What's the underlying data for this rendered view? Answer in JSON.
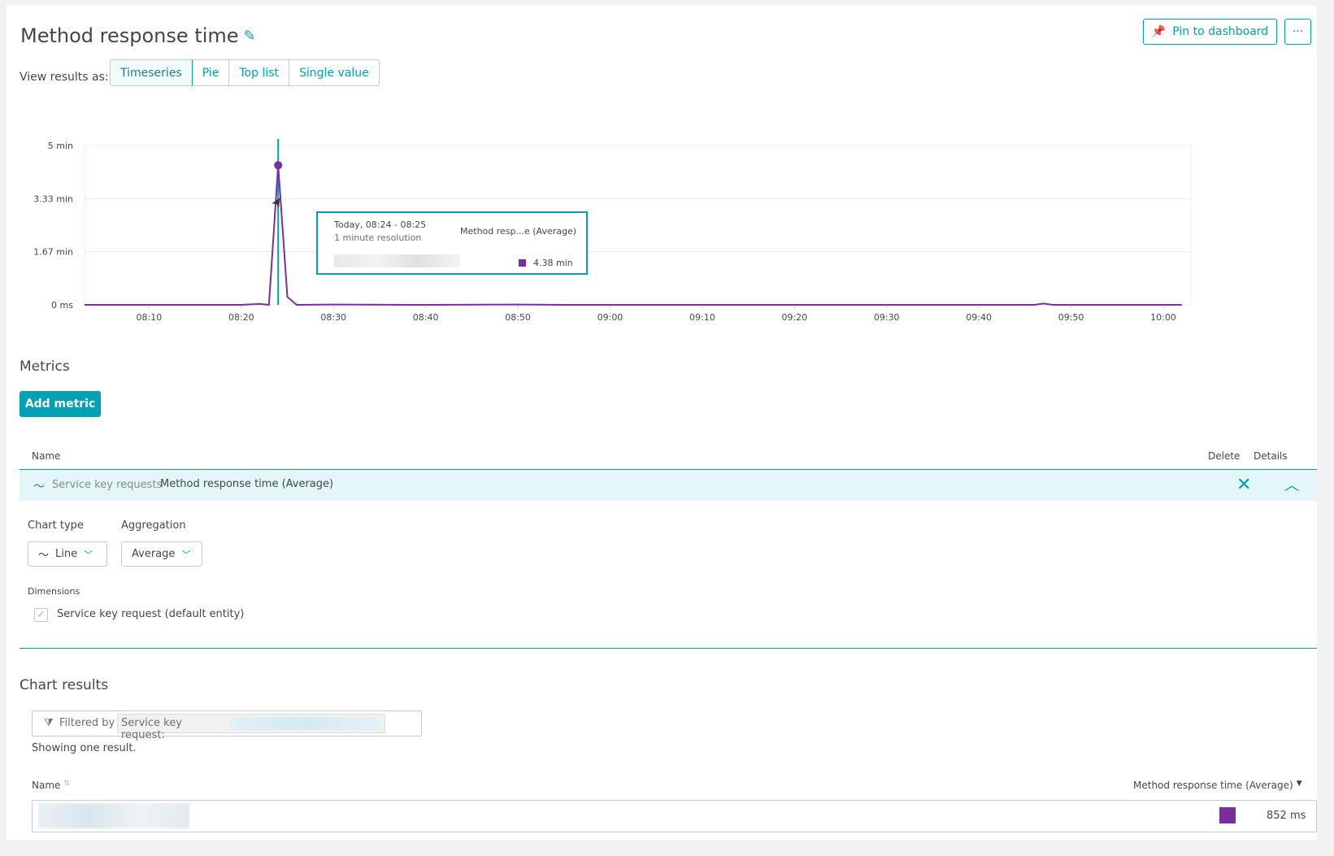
{
  "header": {
    "title": "Method response time",
    "pin_label": "Pin to dashboard",
    "more_label": "···",
    "view_label": "View results as:",
    "view_options": [
      "Timeseries",
      "Pie",
      "Top list",
      "Single value"
    ],
    "view_selected": "Timeseries"
  },
  "chart_data": {
    "type": "line",
    "title": "",
    "xlabel": "",
    "ylabel": "",
    "y_ticks": [
      "5 min",
      "3.33 min",
      "1.67 min",
      "0 ms"
    ],
    "ylim": [
      0,
      5
    ],
    "y_unit": "min",
    "x_ticks": [
      "08:10",
      "08:20",
      "08:30",
      "08:40",
      "08:50",
      "09:00",
      "09:10",
      "09:20",
      "09:30",
      "09:40",
      "09:50",
      "10:00"
    ],
    "xlim": [
      "08:03",
      "10:03"
    ],
    "grid": true,
    "series": [
      {
        "name": "Method response time (Average)",
        "color": "#7b2e9e",
        "x": [
          "08:03",
          "08:10",
          "08:20",
          "08:22",
          "08:23",
          "08:24",
          "08:25",
          "08:26",
          "08:30",
          "08:40",
          "08:50",
          "08:55",
          "09:00",
          "09:10",
          "09:20",
          "09:30",
          "09:40",
          "09:46",
          "09:47",
          "09:48",
          "09:50",
          "10:00",
          "10:02"
        ],
        "values": [
          0.0,
          0.0,
          0.0,
          0.03,
          0.0,
          4.38,
          0.25,
          0.0,
          0.01,
          0.0,
          0.01,
          0.0,
          0.0,
          0.0,
          0.0,
          0.0,
          0.0,
          0.0,
          0.04,
          0.0,
          0.0,
          0.0,
          0.0
        ]
      }
    ],
    "cursor_x": "08:24",
    "highlight": {
      "x": "08:24",
      "value": 4.38
    }
  },
  "tooltip": {
    "time": "Today, 08:24 - 08:25",
    "resolution": "1 minute resolution",
    "metric": "Method resp...e (Average)",
    "value": "4.38 min",
    "color": "#7b2e9e"
  },
  "metrics": {
    "title": "Metrics",
    "add_label": "Add metric",
    "col_name": "Name",
    "col_delete": "Delete",
    "col_details": "Details",
    "row": {
      "category": "Service key requests",
      "name": "Method response time (Average)"
    },
    "chart_type_label": "Chart type",
    "chart_type_value": "Line",
    "aggregation_label": "Aggregation",
    "aggregation_value": "Average",
    "dimensions_label": "Dimensions",
    "dimension_item": "Service key request (default entity)"
  },
  "results": {
    "title": "Chart results",
    "filtered_by": "Filtered by",
    "filter_tag": "Service key request:",
    "showing": "Showing one result.",
    "col_name": "Name",
    "col_metric": "Method response time (Average)",
    "row_value": "852 ms",
    "row_color": "#7b2e9e"
  },
  "colors": {
    "accent": "#00a1b2",
    "series": "#7b2e9e"
  }
}
